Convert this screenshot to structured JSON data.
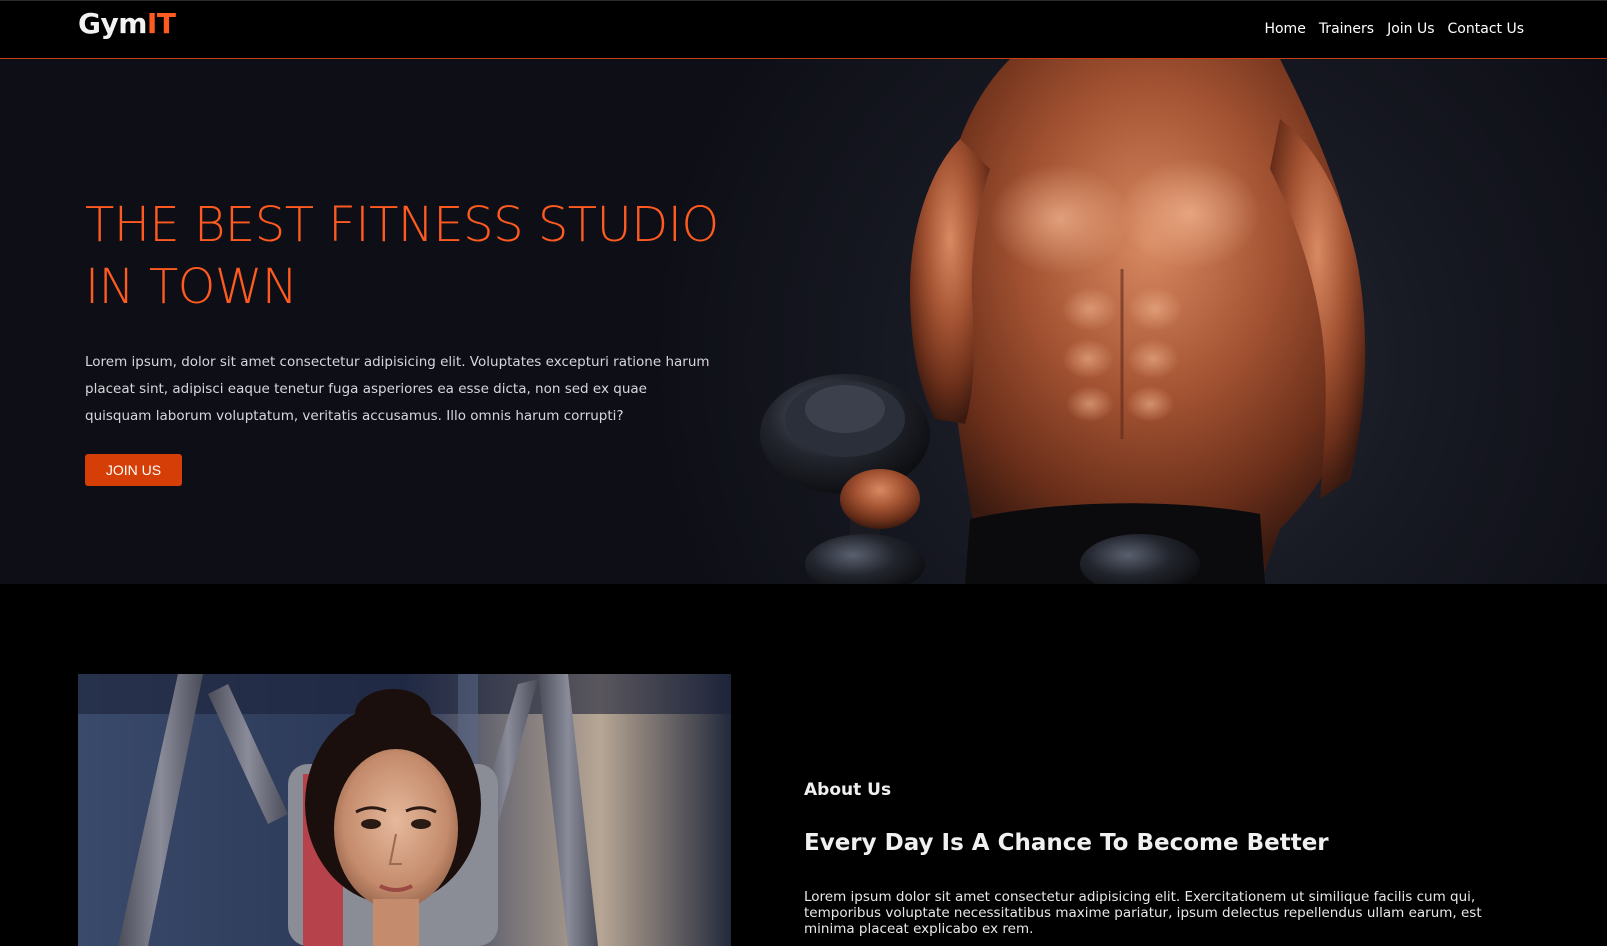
{
  "brand": {
    "name_main": "Gym",
    "name_accent": "IT"
  },
  "nav": {
    "items": [
      {
        "label": "Home"
      },
      {
        "label": "Trainers"
      },
      {
        "label": "Join Us"
      },
      {
        "label": "Contact Us"
      }
    ]
  },
  "hero": {
    "title": "THE BEST FITNESS STUDIO IN TOWN",
    "text": "Lorem ipsum, dolor sit amet consectetur adipisicing elit. Voluptates excepturi ratione harum placeat sint, adipisci eaque tenetur fuga asperiores ea esse dicta, non sed ex quae quisquam laborum voluptatum, veritatis accusamus. Illo omnis harum corrupti?",
    "button_label": "JOIN US",
    "image": "bodybuilder-with-dumbbell-photo"
  },
  "about": {
    "label": "About Us",
    "heading": "Every Day Is A Chance To Become Better",
    "text": "Lorem ipsum dolor sit amet consectetur adipisicing elit. Exercitationem ut similique facilis cum qui, temporibus voluptate necessitatibus maxime pariatur, ipsum delectus repellendus ullam earum, est minima placeat explicabo ex rem.",
    "image": "woman-on-gym-machine-photo"
  },
  "colors": {
    "accent": "#ff5a1f",
    "button": "#d53f07",
    "background": "#000000"
  }
}
